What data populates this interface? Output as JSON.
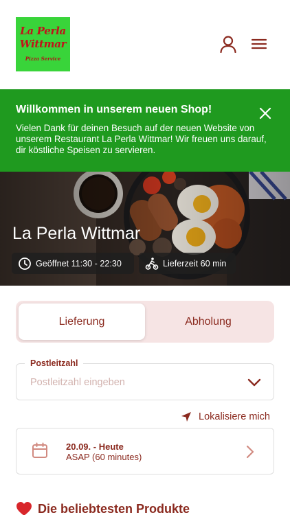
{
  "header": {
    "logo": {
      "line1": "La Perla",
      "line2": "Wittmar",
      "line3": "Pizza Service"
    },
    "user_icon": "user-icon",
    "menu_icon": "hamburger-menu-icon"
  },
  "banner": {
    "title": "Willkommen in unserem neuen Shop!",
    "text": "Vielen Dank für deinen Besuch auf der neuen Website von unserem Restaurant La Perla Wittmar! Wir freuen uns darauf, dir köstliche Speisen zu servieren.",
    "background": "#1f9a1f"
  },
  "hero": {
    "title": "La Perla Wittmar",
    "opening_hours": "Geöffnet 11:30 - 22:30",
    "delivery_time": "Lieferzeit 60 min"
  },
  "mode_toggle": {
    "options": [
      "Lieferung",
      "Abholung"
    ],
    "selected": "Lieferung"
  },
  "zip": {
    "label": "Postleitzahl",
    "placeholder": "Postleitzahl eingeben",
    "value": ""
  },
  "locate": {
    "label": "Lokalisiere mich"
  },
  "schedule": {
    "date": "20.09. - Heute",
    "time": "ASAP (60 minutes)"
  },
  "popular": {
    "title": "Die beliebtesten Produkte",
    "icon": "heart-icon"
  },
  "colors": {
    "accent": "#8b2a1f",
    "banner_green": "#1f9a1f",
    "logo_green": "#39d43a",
    "toggle_bg": "#f6e4e4"
  }
}
